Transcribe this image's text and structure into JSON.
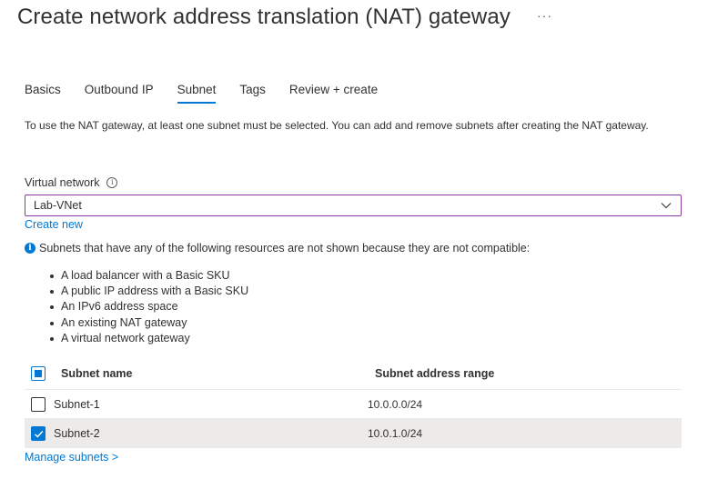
{
  "page": {
    "title": "Create network address translation (NAT) gateway",
    "more_label": "···"
  },
  "tabs": [
    {
      "label": "Basics",
      "active": false
    },
    {
      "label": "Outbound IP",
      "active": false
    },
    {
      "label": "Subnet",
      "active": true
    },
    {
      "label": "Tags",
      "active": false
    },
    {
      "label": "Review + create",
      "active": false
    }
  ],
  "description": "To use the NAT gateway, at least one subnet must be selected. You can add and remove subnets after creating the NAT gateway.",
  "virtual_network": {
    "label": "Virtual network",
    "info_icon": "info-icon",
    "value": "Lab-VNet",
    "create_new": "Create new"
  },
  "notice": {
    "icon": "info-filled-icon",
    "text": "Subnets that have any of the following resources are not shown because they are not compatible:",
    "items": [
      "A load balancer with a Basic SKU",
      "A public IP address with a Basic SKU",
      "An IPv6 address space",
      "An existing NAT gateway",
      "A virtual network gateway"
    ]
  },
  "subnet_table": {
    "headers": {
      "name": "Subnet name",
      "range": "Subnet address range"
    },
    "select_all_state": "indeterminate",
    "rows": [
      {
        "name": "Subnet-1",
        "range": "10.0.0.0/24",
        "checked": false
      },
      {
        "name": "Subnet-2",
        "range": "10.0.1.0/24",
        "checked": true
      }
    ]
  },
  "manage_subnets": "Manage subnets >",
  "colors": {
    "accent": "#0078d4",
    "focus_border": "#8a3a9e",
    "selected_row": "#edebe9",
    "text": "#323130"
  }
}
